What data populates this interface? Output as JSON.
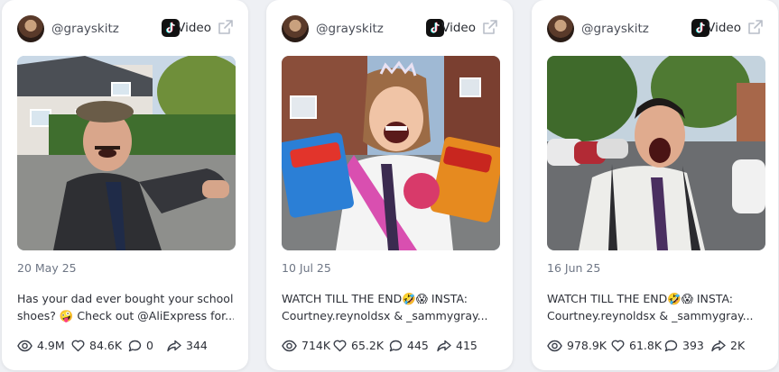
{
  "colors": {
    "background": "#eef0f4",
    "card": "#ffffff",
    "text": "#2d3038",
    "muted": "#6e7685"
  },
  "icons": {
    "views": "eye-icon",
    "likes": "heart-icon",
    "comments": "comment-icon",
    "shares": "share-arrow-icon",
    "platform": "tiktok-icon",
    "open": "external-link-icon"
  },
  "cards": [
    {
      "handle": "@grayskitz",
      "type_label": "Video",
      "date": "20 May 25",
      "caption_line1": "Has your dad ever bought your school",
      "caption_line2": "shoes? 🤪 Check out @AliExpress for...",
      "views": "4.9M",
      "likes": "84.6K",
      "comments": "0",
      "shares": "344"
    },
    {
      "handle": "@grayskitz",
      "type_label": "Video",
      "date": "10 Jul 25",
      "caption_line1": "WATCH TILL THE END🤣😱 INSTA:",
      "caption_line2": "Courtney.reynoldsx & _sammygray...",
      "views": "714K",
      "likes": "65.2K",
      "comments": "445",
      "shares": "415"
    },
    {
      "handle": "@grayskitz",
      "type_label": "Video",
      "date": "16 Jun 25",
      "caption_line1": "WATCH TILL THE END🤣😱 INSTA:",
      "caption_line2": "Courtney.reynoldsx & _sammygray...",
      "views": "978.9K",
      "likes": "61.8K",
      "comments": "393",
      "shares": "2K"
    }
  ]
}
